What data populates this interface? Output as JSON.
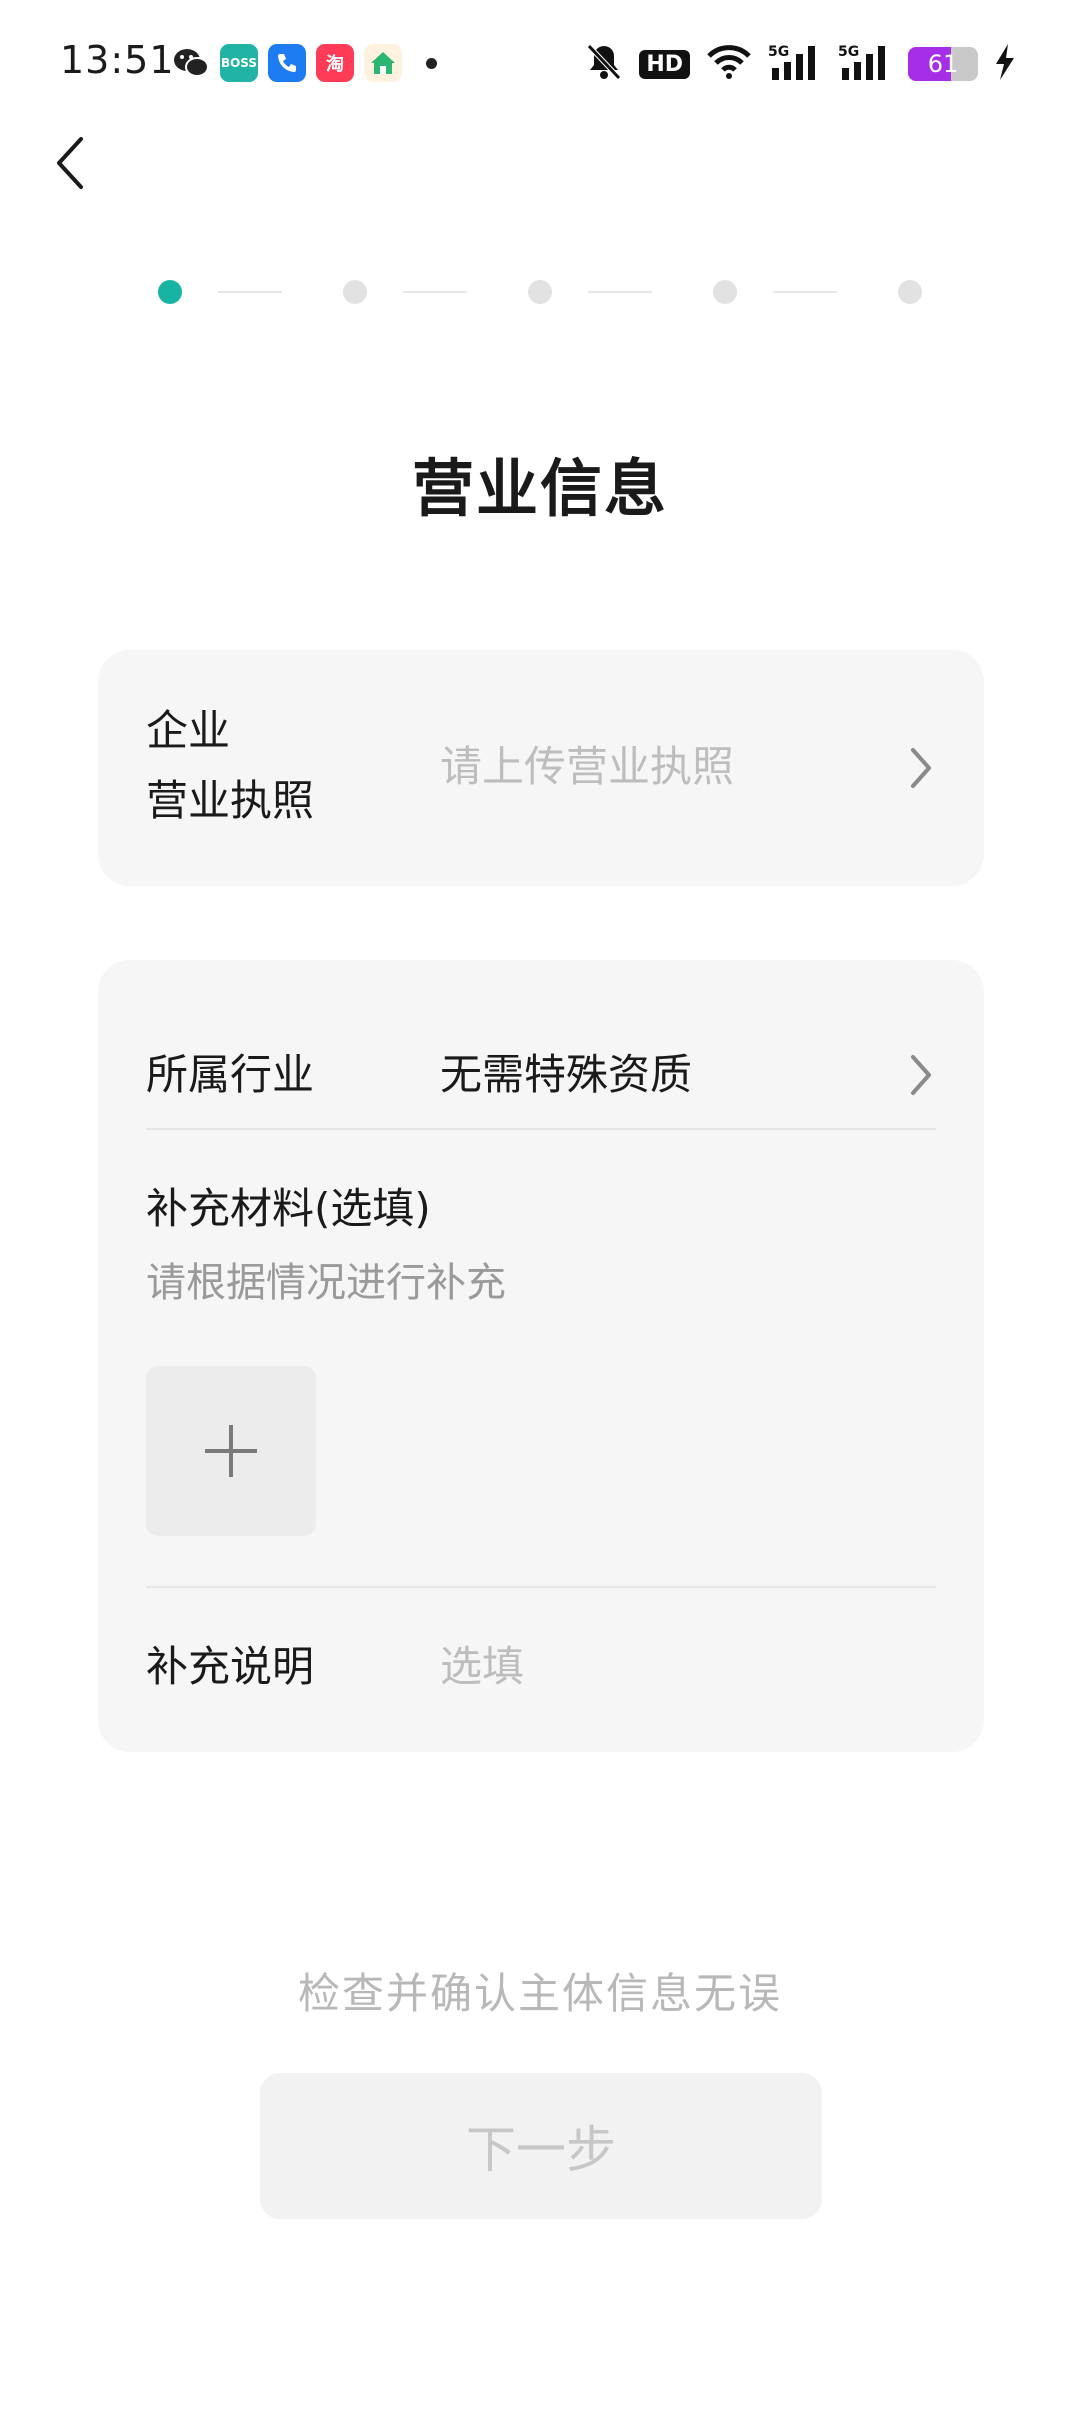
{
  "status_bar": {
    "time": "13:51",
    "battery_level": 61,
    "battery_text": "61",
    "hd_label": "HD",
    "signal_label": "5G",
    "apps": [
      {
        "name": "wechat-icon",
        "color": "#222222",
        "glyph": "●"
      },
      {
        "name": "boss-icon",
        "color": "#21b3a3",
        "glyph": "B"
      },
      {
        "name": "phone-icon",
        "color": "#1d7cf2",
        "glyph": "✆"
      },
      {
        "name": "taobao-icon",
        "color": "#ff3b57",
        "glyph": "淘"
      },
      {
        "name": "home-app-icon",
        "color": "#ff9c2a",
        "glyph": "⌂"
      }
    ]
  },
  "steps": {
    "total": 5,
    "current": 1,
    "active_color": "#17b3a3"
  },
  "title": "营业信息",
  "license": {
    "label_line1": "企业",
    "label_line2": "营业执照",
    "placeholder": "请上传营业执照"
  },
  "industry": {
    "label": "所属行业",
    "value": "无需特殊资质"
  },
  "supplement": {
    "label": "补充材料(选填)",
    "hint": "请根据情况进行补充"
  },
  "note": {
    "label": "补充说明",
    "placeholder": "选填"
  },
  "confirm_text": "检查并确认主体信息无误",
  "next_button": "下一步"
}
